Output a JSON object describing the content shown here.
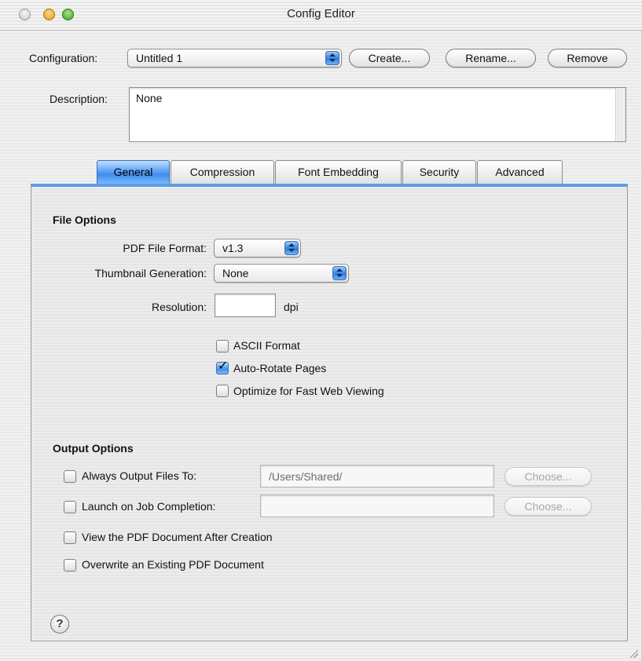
{
  "window": {
    "title": "Config Editor"
  },
  "configuration": {
    "label": "Configuration:",
    "selected": "Untitled 1",
    "create_label": "Create...",
    "rename_label": "Rename...",
    "remove_label": "Remove"
  },
  "description": {
    "label": "Description:",
    "value": "None"
  },
  "tabs": [
    {
      "label": "General",
      "active": true
    },
    {
      "label": "Compression",
      "active": false
    },
    {
      "label": "Font Embedding",
      "active": false
    },
    {
      "label": "Security",
      "active": false
    },
    {
      "label": "Advanced",
      "active": false
    }
  ],
  "file_options": {
    "heading": "File Options",
    "pdf_format_label": "PDF File Format:",
    "pdf_format_value": "v1.3",
    "thumbnail_label": "Thumbnail Generation:",
    "thumbnail_value": "None",
    "resolution_label": "Resolution:",
    "resolution_value": "",
    "resolution_unit": "dpi",
    "checkboxes": [
      {
        "label": "ASCII Format",
        "checked": false
      },
      {
        "label": "Auto-Rotate Pages",
        "checked": true
      },
      {
        "label": "Optimize for Fast Web Viewing",
        "checked": false
      }
    ]
  },
  "output_options": {
    "heading": "Output Options",
    "always_output": {
      "label": "Always Output Files To:",
      "checked": false,
      "path": "/Users/Shared/",
      "choose_label": "Choose..."
    },
    "launch_on_completion": {
      "label": "Launch on Job Completion:",
      "checked": false,
      "path": "",
      "choose_label": "Choose..."
    },
    "view_after": {
      "label": "View the PDF Document After Creation",
      "checked": false
    },
    "overwrite": {
      "label": "Overwrite an Existing PDF Document",
      "checked": false
    }
  },
  "help": {
    "glyph": "?"
  },
  "icons": [
    "close-button-icon",
    "minimize-button-icon",
    "zoom-button-icon",
    "popup-arrows-icon",
    "checkmark-icon",
    "help-icon",
    "resize-grip-icon"
  ],
  "colors": {
    "accent": "#3d8ef0",
    "minimize": "#e39a12",
    "zoom": "#3ca21c"
  }
}
